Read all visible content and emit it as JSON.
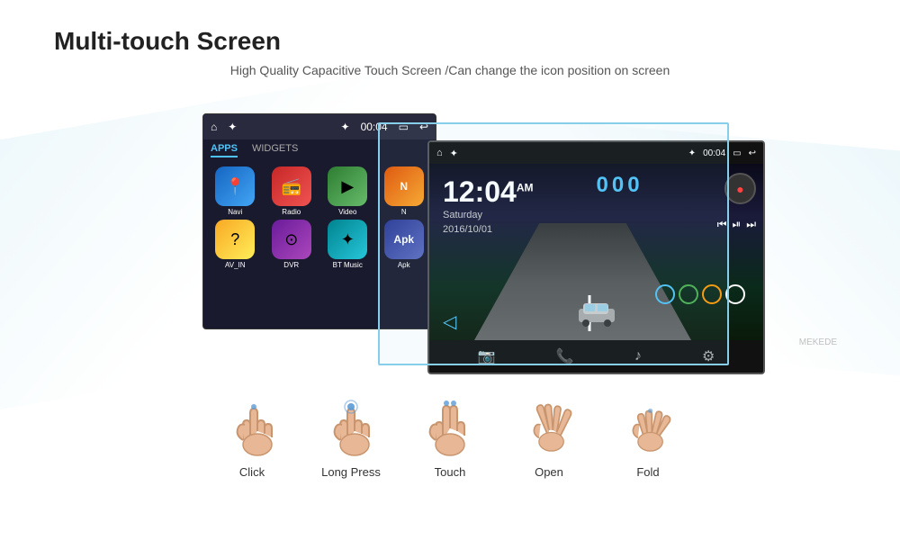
{
  "page": {
    "title": "Multi-touch Screen",
    "subtitle": "High Quality Capacitive Touch Screen /Can change the icon position on screen"
  },
  "back_screen": {
    "tabs": [
      "APPS",
      "WIDGETS"
    ],
    "apps": [
      {
        "label": "Navi",
        "color": "blue",
        "icon": "📍"
      },
      {
        "label": "Radio",
        "color": "red",
        "icon": "📻"
      },
      {
        "label": "Video",
        "color": "green",
        "icon": "▶"
      },
      {
        "label": "N",
        "color": "orange",
        "icon": "N"
      },
      {
        "label": "AV_IN",
        "color": "yellow",
        "icon": "?"
      },
      {
        "label": "DVR",
        "color": "purple",
        "icon": "⊙"
      },
      {
        "label": "BT Music",
        "color": "cyan",
        "icon": "✦"
      },
      {
        "label": "Apk",
        "color": "indigo",
        "icon": "A"
      }
    ]
  },
  "front_screen": {
    "time": "12:04",
    "ampm": "AM",
    "day": "Saturday",
    "date": "2016/10/01",
    "music_code": "000"
  },
  "gestures": [
    {
      "id": "click",
      "label": "Click"
    },
    {
      "id": "long-press",
      "label": "Long Press"
    },
    {
      "id": "touch",
      "label": "Touch"
    },
    {
      "id": "open",
      "label": "Open"
    },
    {
      "id": "fold",
      "label": "Fold"
    }
  ],
  "watermark": "MEKEDE"
}
